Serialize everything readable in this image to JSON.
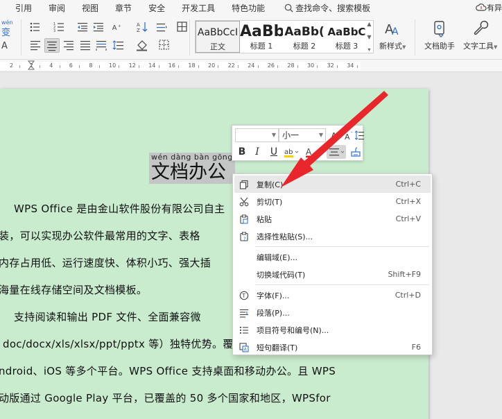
{
  "menu": {
    "tabs": [
      "引用",
      "审阅",
      "视图",
      "章节",
      "安全",
      "开发工具",
      "特色功能"
    ],
    "search": "查找命令、搜索模板",
    "sync_status": "有异"
  },
  "ribbon": {
    "phonetic_label": "wén",
    "phonetic_char": "变",
    "styles": [
      {
        "sample": "AaBbCcI",
        "name": "正文"
      },
      {
        "sample": "AaBb",
        "name": "标题 1"
      },
      {
        "sample": "AaBb(",
        "name": "标题 2"
      },
      {
        "sample": "AaBbC",
        "name": "标题 3"
      }
    ],
    "new_style": "新样式",
    "doc_helper": "文档助手",
    "text_tools": "文字工具"
  },
  "ruler": {
    "labels": [
      "2",
      "2",
      "4",
      "6",
      "8",
      "10",
      "12",
      "14",
      "16",
      "18",
      "20",
      "22",
      "24",
      "26",
      "28",
      "30",
      "32",
      "34"
    ]
  },
  "document": {
    "title_pinyin": "wén dàng bàn gōng",
    "title": "文档办公",
    "lines": [
      "WPS Office 是由金山软件股份有限公司自主",
      "装，可以实现办公软件最常用的文字、表格",
      "内存占用低、运行速度快、体积小巧、强大插",
      "海量在线存储空间及文档模板。",
      "支持阅读和输出 PDF 文件、全面兼容微",
      "doc/docx/xls/xlsx/ppt/pptx 等）独特优势。覆",
      "ndroid、iOS 等多个平台。WPS Office 支持桌面和移动办公。且 WPS",
      "动版通过 Google Play 平台，已覆盖的 50 多个国家和地区，WPSfor"
    ]
  },
  "mini_toolbar": {
    "font_name": "",
    "font_size": "小一"
  },
  "context_menu": {
    "items": [
      {
        "label": "复制(C)",
        "shortcut": "Ctrl+C",
        "icon": "copy-icon"
      },
      {
        "label": "剪切(T)",
        "shortcut": "Ctrl+X",
        "icon": "scissors-icon"
      },
      {
        "label": "粘贴",
        "shortcut": "Ctrl+V",
        "icon": "paste-icon"
      },
      {
        "label": "选择性粘贴(S)...",
        "shortcut": "",
        "icon": "paste-special-icon"
      },
      {
        "label": "编辑域(E)...",
        "shortcut": "",
        "icon": ""
      },
      {
        "label": "切换域代码(T)",
        "shortcut": "Shift+F9",
        "icon": ""
      },
      {
        "label": "字体(F)...",
        "shortcut": "Ctrl+D",
        "icon": "font-icon"
      },
      {
        "label": "段落(P)...",
        "shortcut": "",
        "icon": "paragraph-icon"
      },
      {
        "label": "项目符号和编号(N)...",
        "shortcut": "",
        "icon": "bullets-icon"
      },
      {
        "label": "短句翻译(T)",
        "shortcut": "F6",
        "icon": "translate-icon"
      }
    ]
  },
  "colors": {
    "page_bg": "#c9ebce",
    "annotation_arrow": "#e8262b",
    "selection": "#c3c6c5"
  }
}
